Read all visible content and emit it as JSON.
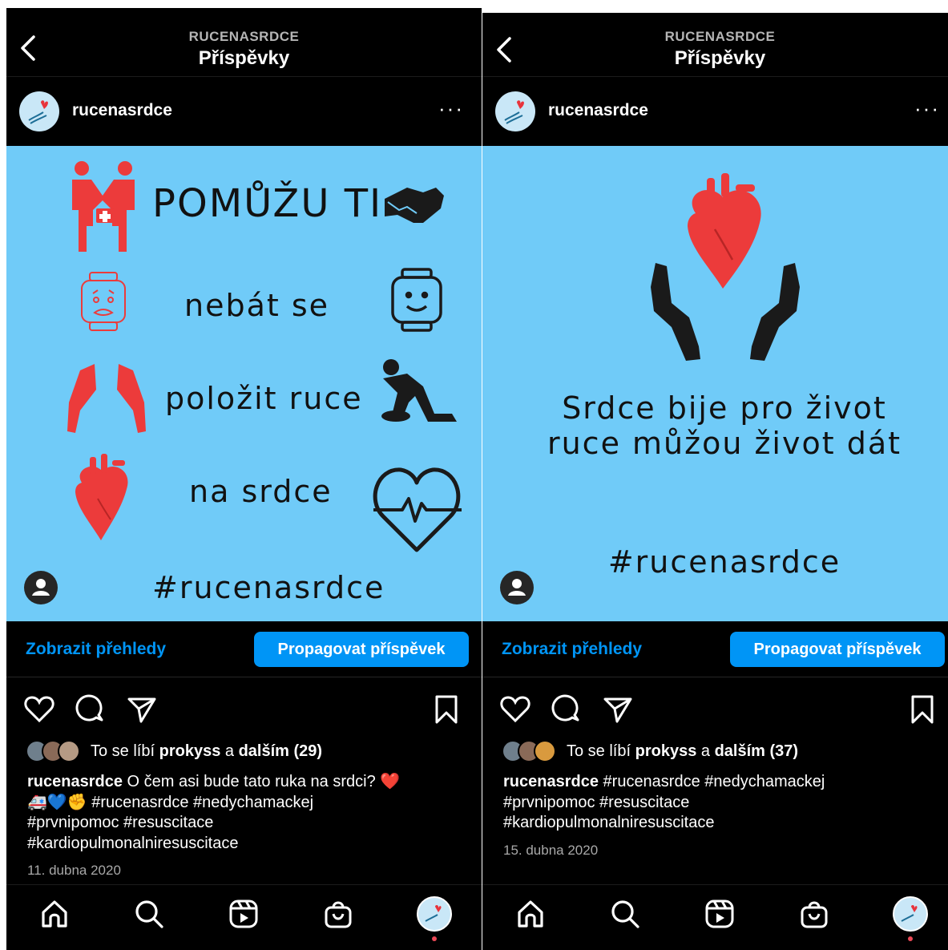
{
  "colors": {
    "post_bg": "#70cbf8",
    "accent_red": "#ec3b3b",
    "link_blue": "#0095f6",
    "icon_dark": "#1a1a1a"
  },
  "panels": [
    {
      "header_small": "RUCENASRDCE",
      "header_big": "Příspěvky",
      "account": "rucenasrdce",
      "more": "···",
      "post_lines": [
        "POMŮŽU TI",
        "nebát se",
        "položit ruce",
        "na srdce",
        "#rucenasrdce"
      ],
      "icons": [
        "helpers-icon",
        "handshake-icon",
        "worried-face-icon",
        "smiley-face-icon",
        "hands-icon",
        "cpr-icon",
        "heart-organ-icon",
        "heartbeat-icon"
      ],
      "insights": "Zobrazit přehledy",
      "promote": "Propagovat příspěvek",
      "likes_prefix": "To se líbí",
      "likes_user": "prokyss",
      "likes_mid": "a",
      "likes_rest": "dalším (29)",
      "caption_user": "rucenasrdce",
      "caption_line1": "O čem asi bude tato ruka na srdci? ❤️",
      "caption_line2": "🚑💙✊ #rucenasrdce #nedychamackej",
      "caption_line3": "#prvnipomoc #resuscitace",
      "caption_line4": "#kardiopulmonalniresuscitace",
      "date": "11. dubna 2020"
    },
    {
      "header_small": "RUCENASRDCE",
      "header_big": "Příspěvky",
      "account": "rucenasrdce",
      "more": "···",
      "post_lines": [
        "Srdce bije pro život",
        "ruce můžou život dát",
        "#rucenasrdce"
      ],
      "icons": [
        "heart-organ-icon",
        "hands-icon"
      ],
      "insights": "Zobrazit přehledy",
      "promote": "Propagovat příspěvek",
      "likes_prefix": "To se líbí",
      "likes_user": "prokyss",
      "likes_mid": "a",
      "likes_rest": "dalším (37)",
      "caption_user": "rucenasrdce",
      "caption_line1": "#rucenasrdce #nedychamackej",
      "caption_line2": "#prvnipomoc #resuscitace",
      "caption_line3": "#kardiopulmonalniresuscitace",
      "date": "15. dubna 2020"
    }
  ]
}
